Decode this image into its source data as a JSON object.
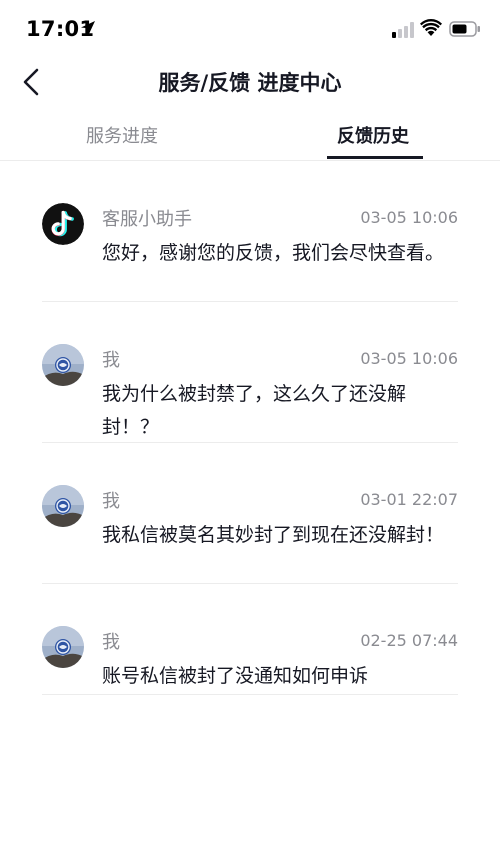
{
  "status_bar": {
    "time": "17:01"
  },
  "nav": {
    "title": "服务/反馈 进度中心"
  },
  "tabs": [
    {
      "label": "服务进度",
      "active": false
    },
    {
      "label": "反馈历史",
      "active": true
    }
  ],
  "messages": [
    {
      "sender": "客服小助手",
      "time": "03-05 10:06",
      "text": "您好，感谢您的反馈，我们会尽快查看。",
      "avatar": "tiktok-logo"
    },
    {
      "sender": "我",
      "time": "03-05 10:06",
      "text": "我为什么被封禁了，这么久了还没解封！？",
      "avatar": "user-photo"
    },
    {
      "sender": "我",
      "time": "03-01 22:07",
      "text": "我私信被莫名其妙封了到现在还没解封！",
      "avatar": "user-photo"
    },
    {
      "sender": "我",
      "time": "02-25 07:44",
      "text": "账号私信被封了没通知如何申诉",
      "avatar": "user-photo"
    }
  ],
  "colors": {
    "primary_text": "#161823",
    "secondary_text": "#8a8b91",
    "divider": "#ececec",
    "accent_red": "#fe2c55",
    "accent_cyan": "#25f4ee"
  }
}
